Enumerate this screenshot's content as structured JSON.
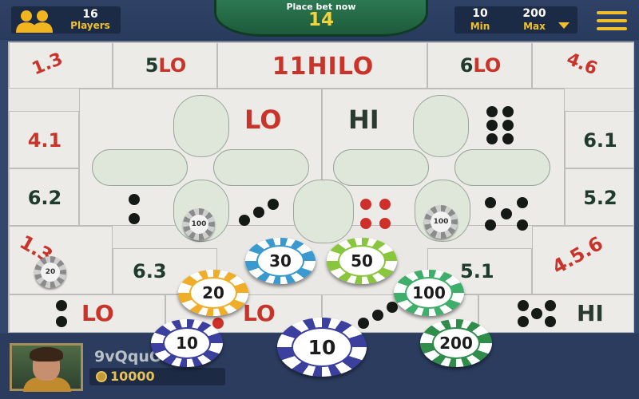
{
  "header": {
    "players_count": "16",
    "players_label": "Players",
    "bet_prompt": "Place bet now",
    "timer": "14",
    "min_value": "10",
    "min_label": "Min",
    "max_value": "200",
    "max_label": "Max"
  },
  "table": {
    "top_row": [
      "1.3",
      "5LO",
      "11HILO",
      "6LO",
      "4.6"
    ],
    "left_col": [
      "4.1",
      "6.2",
      "1.3"
    ],
    "right_col": [
      "6.1",
      "5.2",
      "4.5.6"
    ],
    "lo_label": "LO",
    "hi_label": "HI",
    "pair_6_3": "6.3",
    "pair_5_1": "5.1",
    "bottom_lo_1": "LO",
    "bottom_lo_2": "LO",
    "bottom_hi": "HI"
  },
  "placed_chips": [
    "100",
    "100",
    "20"
  ],
  "chip_rack": [
    "30",
    "50",
    "20",
    "100",
    "10",
    "10",
    "200"
  ],
  "player": {
    "name": "9vQquO",
    "balance": "10000"
  },
  "colors": {
    "background": "#33476d",
    "accent_yellow": "#f2c02c",
    "table_red": "#c9342a",
    "table_felt": "#e9e8e5"
  }
}
